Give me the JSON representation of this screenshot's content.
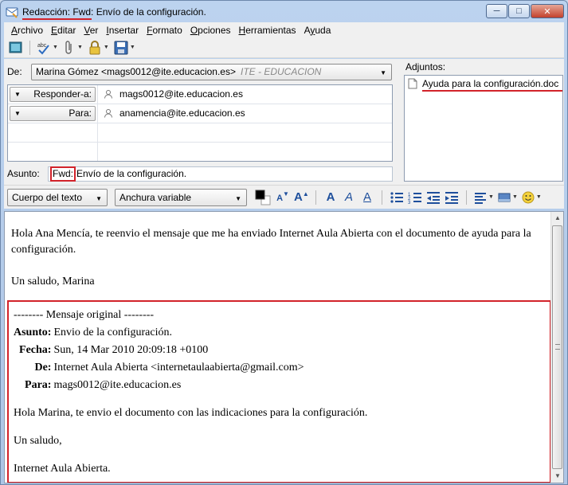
{
  "window": {
    "title_prefix": "Redacción: Fwd:",
    "title_rest": " Envío de la configuración."
  },
  "menu": [
    {
      "accel": "A",
      "rest": "rchivo"
    },
    {
      "accel": "E",
      "rest": "ditar"
    },
    {
      "accel": "V",
      "rest": "er"
    },
    {
      "accel": "I",
      "rest": "nsertar"
    },
    {
      "accel": "F",
      "rest": "ormato"
    },
    {
      "accel": "O",
      "rest": "pciones"
    },
    {
      "accel": "H",
      "rest": "erramientas"
    },
    {
      "accel": "y",
      "rest": "uda",
      "pre": "A"
    }
  ],
  "header": {
    "from_label": "De:",
    "from_value": "Marina Gómez <mags0012@ite.educacion.es>",
    "from_identity": "ITE - EDUCACION",
    "recipients": [
      {
        "type": "Responder-a:",
        "address": "mags0012@ite.educacion.es"
      },
      {
        "type": "Para:",
        "address": "anamencia@ite.educacion.es"
      }
    ],
    "subject_label": "Asunto:",
    "subject_fwd": "Fwd:",
    "subject_rest": " Envío de la configuración."
  },
  "attachments": {
    "label": "Adjuntos:",
    "items": [
      "Ayuda para la configuración.doc"
    ]
  },
  "format": {
    "paragraph_style": "Cuerpo del texto",
    "font": "Anchura variable"
  },
  "body": {
    "intro": "Hola Ana Mencía, te reenvio el mensaje que me ha enviado Internet Aula Abierta con el documento de ayuda para la configuración.",
    "signoff": "Un saludo,  Marina",
    "forward_header": "-------- Mensaje original --------",
    "fields": [
      {
        "key": "Asunto:",
        "value": "Envio de la configuración."
      },
      {
        "key": "Fecha:",
        "value": "Sun, 14 Mar 2010 20:09:18 +0100"
      },
      {
        "key": "De:",
        "value": "Internet Aula Abierta <internetaulaabierta@gmail.com>"
      },
      {
        "key": "Para:",
        "value": "mags0012@ite.educacion.es"
      }
    ],
    "orig_text": "Hola Marina, te envio el documento con las indicaciones para la configuración.",
    "orig_signoff": "Un saludo,",
    "orig_signature": "Internet Aula Abierta."
  }
}
